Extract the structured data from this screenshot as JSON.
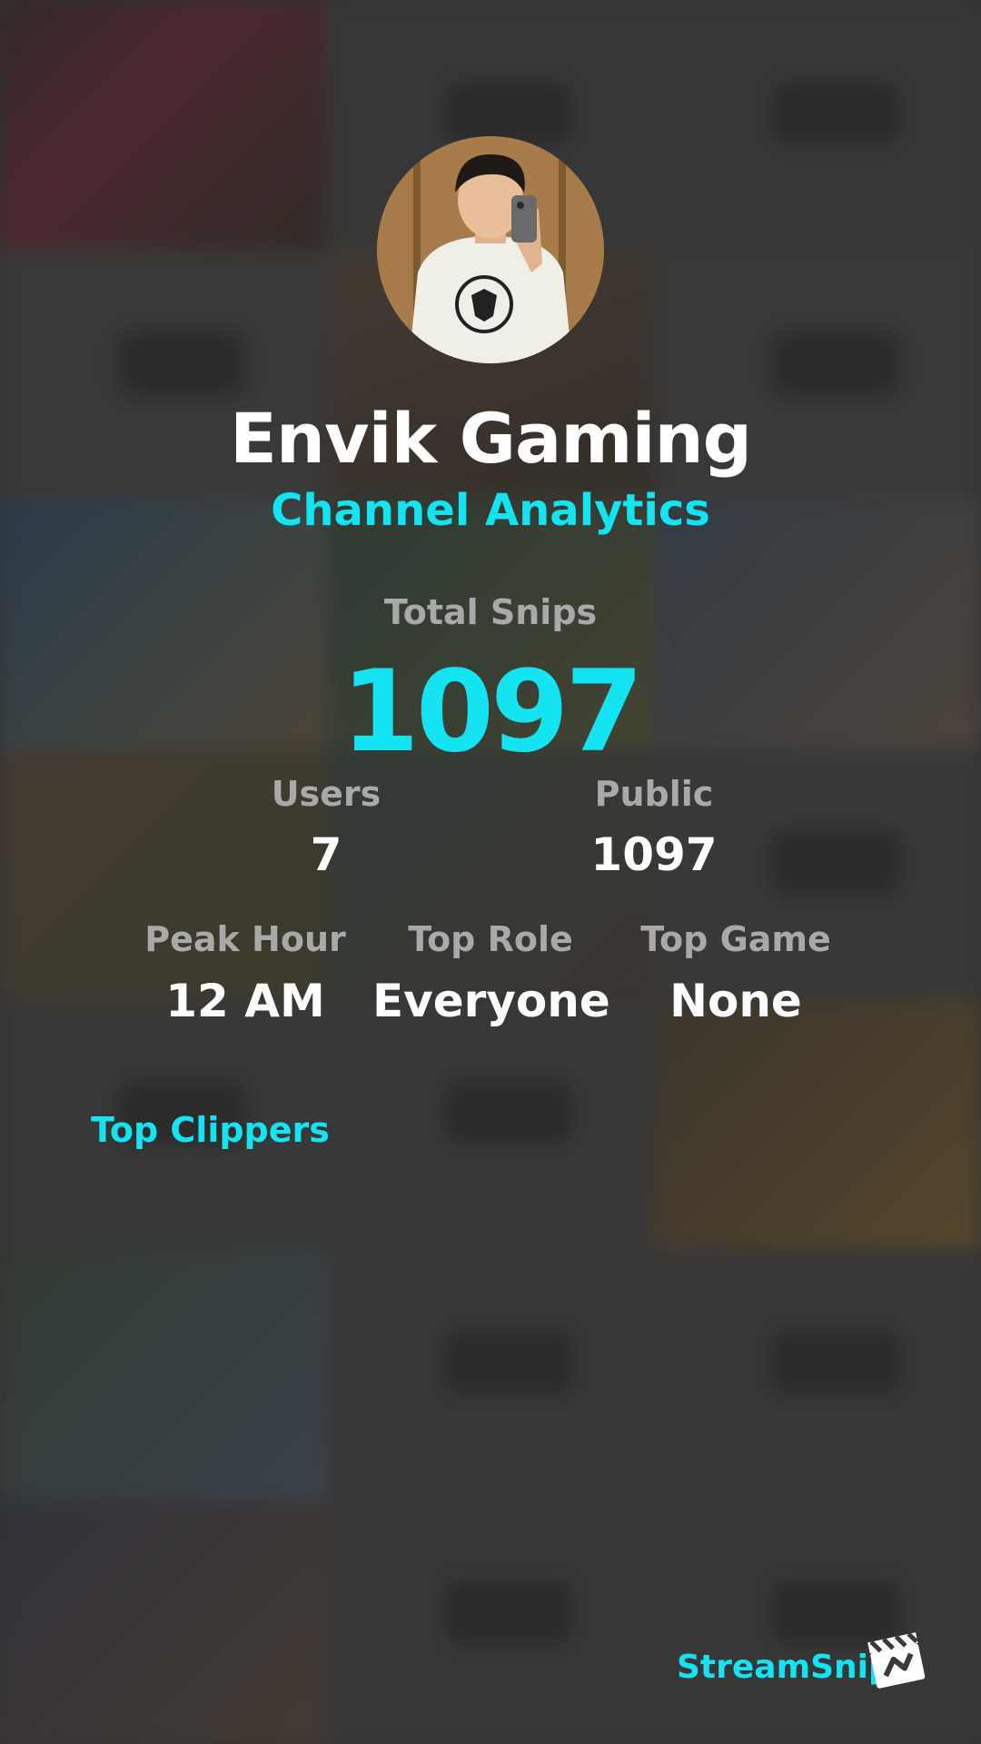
{
  "profile": {
    "channel_name": "Envik Gaming",
    "subtitle": "Channel Analytics",
    "avatar_icon": "user-photo-avatar"
  },
  "stats": {
    "total_label": "Total Snips",
    "total_value": "1097",
    "users_label": "Users",
    "users_value": "7",
    "public_label": "Public",
    "public_value": "1097",
    "peak_hour_label": "Peak Hour",
    "peak_hour_value": "12 AM",
    "top_role_label": "Top Role",
    "top_role_value": "Everyone",
    "top_game_label": "Top Game",
    "top_game_value": "None"
  },
  "sections": {
    "top_clippers": "Top Clippers"
  },
  "footer": {
    "brand": "StreamSnip",
    "logo_icon": "clapperboard-icon"
  },
  "colors": {
    "accent": "#14e3f2",
    "label": "#a9a9a9",
    "text": "#ffffff",
    "background": "#3a3a3a"
  }
}
